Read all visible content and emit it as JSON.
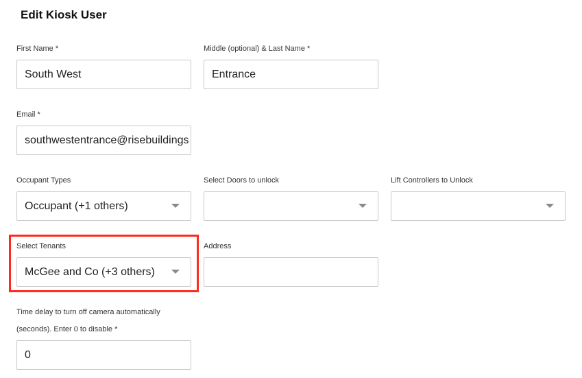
{
  "page": {
    "title": "Edit Kiosk User"
  },
  "form": {
    "first_name": {
      "label": "First Name *",
      "value": "South West"
    },
    "last_name": {
      "label": "Middle (optional) & Last Name *",
      "value": "Entrance"
    },
    "email": {
      "label": "Email *",
      "value": "southwestentrance@risebuildings"
    },
    "occupant_types": {
      "label": "Occupant Types",
      "value": "Occupant (+1 others)"
    },
    "doors": {
      "label": "Select Doors to unlock",
      "value": ""
    },
    "lift_controllers": {
      "label": "Lift Controllers to Unlock",
      "value": ""
    },
    "tenants": {
      "label": "Select Tenants",
      "value": "McGee and Co (+3 others)"
    },
    "address": {
      "label": "Address",
      "value": ""
    },
    "camera_delay": {
      "label_line1": "Time delay to turn off camera automatically",
      "label_line2": "(seconds). Enter 0 to disable *",
      "value": "0"
    }
  },
  "icons": {
    "dropdown": "chevron-down-icon"
  },
  "colors": {
    "highlight": "#ff2a1a",
    "border": "#c8c8c8",
    "caret": "#8a8a8a"
  }
}
